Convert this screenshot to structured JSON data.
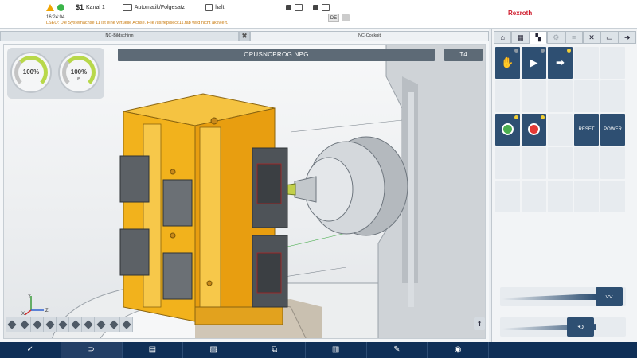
{
  "topbar": {
    "channel_number": "$1",
    "channel_label": "Kanal 1",
    "mode_label": "Automatik/Folgesatz",
    "state_label": "halt",
    "clock": "16:24:04",
    "language": "DE",
    "message": "LSEO: Die Systemachse 11 ist eine virtuelle Achse. File /usrfep/secc11.tab wird nicht aktiviert.",
    "brand": "Rexroth"
  },
  "panels": {
    "left_tab": "NC-Bildschirm",
    "right_tab": "NC-Cockpit",
    "close_glyph": "✖"
  },
  "gauges": [
    {
      "value": "100%",
      "sub": ""
    },
    {
      "value": "100%",
      "sub": "⚟"
    }
  ],
  "program": {
    "name": "OPUSNCPROG.NPG",
    "tool": "T4"
  },
  "axes": {
    "x": "X",
    "y": "Y",
    "z": "Z"
  },
  "view_toolbar": [
    "iso-view",
    "front-view",
    "top-view",
    "side-view",
    "wire-view",
    "cut-view",
    "grid-view",
    "measure-view",
    "rotate-view",
    "mill-view"
  ],
  "up_glyph": "⬆",
  "bottom_buttons": [
    {
      "icon": "checkmark-icon",
      "glyph": "✓"
    },
    {
      "icon": "return-icon",
      "glyph": "⊃"
    },
    {
      "icon": "list-icon",
      "glyph": "▤"
    },
    {
      "icon": "image-icon",
      "glyph": "▨"
    },
    {
      "icon": "copy-icon",
      "glyph": "⧉"
    },
    {
      "icon": "bar-chart-icon",
      "glyph": "▥"
    },
    {
      "icon": "wrench-icon",
      "glyph": "✎"
    },
    {
      "icon": "eye-icon",
      "glyph": "◉"
    }
  ],
  "right_tabs": [
    {
      "icon": "home-icon",
      "glyph": "⌂"
    },
    {
      "icon": "keyboard-icon",
      "glyph": "▦"
    },
    {
      "icon": "cockpit-icon",
      "glyph": "▚"
    },
    {
      "icon": "gear-icon",
      "glyph": "⚙"
    },
    {
      "icon": "list-edit-icon",
      "glyph": "≡"
    },
    {
      "icon": "tools-icon",
      "glyph": "✕"
    },
    {
      "icon": "display-icon",
      "glyph": "▭"
    },
    {
      "icon": "next-icon",
      "glyph": "➜"
    }
  ],
  "control_buttons": {
    "reset": "RESET",
    "power": "POWER"
  },
  "sliders": [
    {
      "fraction": 1.0,
      "glyph": "〰"
    },
    {
      "fraction": 0.7,
      "glyph": "⟲"
    }
  ]
}
